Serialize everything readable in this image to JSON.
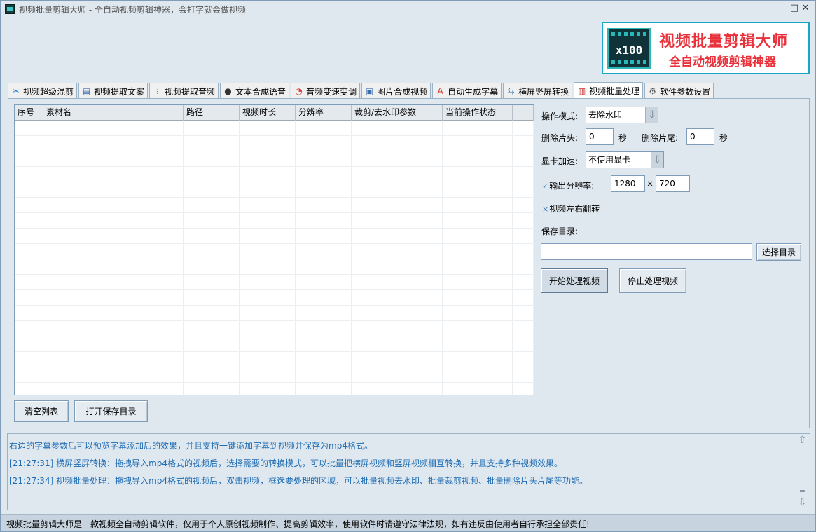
{
  "window": {
    "title": "视频批量剪辑大师 - 全自动视频剪辑神器，会打字就会做视频",
    "controls": [
      "‒",
      "□",
      "✕"
    ]
  },
  "banner": {
    "logo_text": "x100",
    "title": "视频批量剪辑大师",
    "subtitle": "全自动视频剪辑神器"
  },
  "tabs": [
    {
      "label": "视频超级混剪",
      "icon": "scissors-icon",
      "glyph": "✂",
      "color": "#1d7fcf"
    },
    {
      "label": "视频提取文案",
      "icon": "document-icon",
      "glyph": "▤",
      "color": "#3a6fb0"
    },
    {
      "label": "视频提取音频",
      "icon": "audio-wave-icon",
      "glyph": "⦙",
      "color": "#2aa35a"
    },
    {
      "label": "文本合成语音",
      "icon": "microphone-icon",
      "glyph": "●",
      "color": "#333333"
    },
    {
      "label": "音频变速变调",
      "icon": "speedometer-icon",
      "glyph": "◔",
      "color": "#d23a3a"
    },
    {
      "label": "图片合成视频",
      "icon": "image-icon",
      "glyph": "▣",
      "color": "#3a6fb0"
    },
    {
      "label": "自动生成字幕",
      "icon": "font-icon",
      "glyph": "A",
      "color": "#d23a3a"
    },
    {
      "label": "横屏竖屏转换",
      "icon": "rotate-screen-icon",
      "glyph": "⇆",
      "color": "#2a6aa8"
    },
    {
      "label": "视频批量处理",
      "icon": "film-icon",
      "glyph": "▥",
      "color": "#c62828"
    },
    {
      "label": "软件参数设置",
      "icon": "gear-icon",
      "glyph": "⚙",
      "color": "#555555"
    }
  ],
  "active_tab": 8,
  "table": {
    "columns": [
      "序号",
      "素材名",
      "路径",
      "视频时长",
      "分辨率",
      "裁剪/去水印参数",
      "当前操作状态",
      ""
    ],
    "rows": []
  },
  "left_buttons": {
    "clear": "清空列表",
    "open_dir": "打开保存目录"
  },
  "settings": {
    "mode_label": "操作模式:",
    "mode_value": "去除水印",
    "trim_head_label": "删除片头:",
    "trim_head_value": "0",
    "trim_tail_label": "删除片尾:",
    "trim_tail_value": "0",
    "seconds_unit": "秒",
    "gpu_label": "显卡加速:",
    "gpu_value": "不使用显卡",
    "resolution_check": "✓",
    "resolution_label": "输出分辨率:",
    "width": "1280",
    "times": "×",
    "height": "720",
    "flip_check": "×",
    "flip_label": "视频左右翻转",
    "save_dir_label": "保存目录:",
    "save_dir_value": "",
    "choose_dir": "选择目录",
    "start": "开始处理视频",
    "stop": "停止处理视频"
  },
  "log": [
    "右边的字幕参数后可以预览字幕添加后的效果，并且支持一键添加字幕到视频并保存为mp4格式。",
    "[21:27:31] 横屏竖屏转换：拖拽导入mp4格式的视频后，选择需要的转换模式，可以批量把横屏视频和竖屏视频相互转换，并且支持多种视频效果。",
    "[21:27:34] 视频批量处理：拖拽导入mp4格式的视频后，双击视频，框选要处理的区域，可以批量视频去水印、批量裁剪视频、批量删除片头片尾等功能。"
  ],
  "status": "视频批量剪辑大师是一款视频全自动剪辑软件，仅用于个人原创视频制作、提高剪辑效率，使用软件时请遵守法律法规，如有违反由使用者自行承担全部责任!"
}
